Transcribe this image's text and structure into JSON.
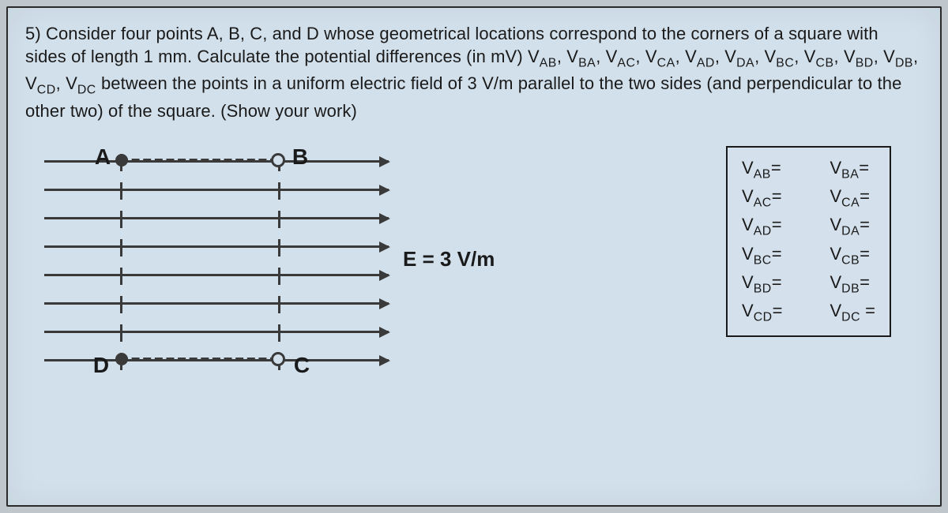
{
  "question": {
    "number": "5)",
    "text_1": "Consider four points A, B, C, and D whose geometrical locations correspond to the corners of a square with sides of length 1 mm. Calculate the potential differences (in mV) ",
    "pairs_list": [
      "AB",
      "BA",
      "AC",
      "CA",
      "AD",
      "DA",
      "BC",
      "CB",
      "BD",
      "DB",
      "CD",
      "DC"
    ],
    "text_2": " between the points in a uniform electric field of 3 V/m parallel to the two sides (and perpendicular to the other two) of the square. (Show your work)"
  },
  "diagram": {
    "corners": {
      "A": "A",
      "B": "B",
      "C": "C",
      "D": "D"
    },
    "field_label": "E = 3 V/m"
  },
  "answers": {
    "left": [
      "AB",
      "AC",
      "AD",
      "BC",
      "BD",
      "CD"
    ],
    "right": [
      "BA",
      "CA",
      "DA",
      "CB",
      "DB",
      "DC"
    ]
  }
}
